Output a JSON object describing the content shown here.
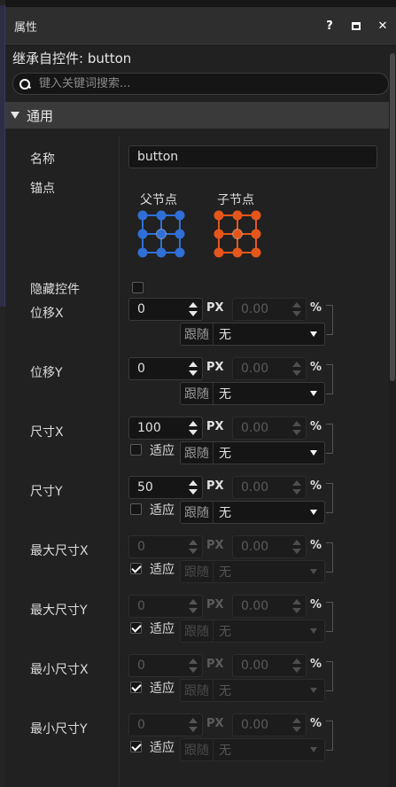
{
  "panel": {
    "title": "属性",
    "help_label": "?",
    "close_label": "✕"
  },
  "inherit_text": "继承自控件: button",
  "search": {
    "placeholder": "键入关键词搜索..."
  },
  "section": {
    "label": "通用"
  },
  "name_field": {
    "label": "名称",
    "value": "button"
  },
  "anchor": {
    "label": "锚点",
    "parent_label": "父节点",
    "child_label": "子节点",
    "parent_color": "#2f6fd6",
    "child_color": "#e5561b"
  },
  "hide_control": {
    "label": "隐藏控件",
    "checked": false
  },
  "rows": [
    {
      "label": "位移X",
      "value": "0",
      "unit": "PX",
      "pct_value": "0.00",
      "pct_unit": "%",
      "fit_label": "",
      "fit_checked": false,
      "follow_tag": "跟随",
      "follow_value": "无"
    },
    {
      "label": "位移Y",
      "value": "0",
      "unit": "PX",
      "pct_value": "0.00",
      "pct_unit": "%",
      "fit_label": "",
      "fit_checked": false,
      "follow_tag": "跟随",
      "follow_value": "无"
    },
    {
      "label": "尺寸X",
      "value": "100",
      "unit": "PX",
      "pct_value": "0.00",
      "pct_unit": "%",
      "fit_label": "适应",
      "fit_checked": false,
      "follow_tag": "跟随",
      "follow_value": "无"
    },
    {
      "label": "尺寸Y",
      "value": "50",
      "unit": "PX",
      "pct_value": "0.00",
      "pct_unit": "%",
      "fit_label": "适应",
      "fit_checked": false,
      "follow_tag": "跟随",
      "follow_value": "无"
    },
    {
      "label": "最大尺寸X",
      "value": "0",
      "unit": "PX",
      "pct_value": "0.00",
      "pct_unit": "%",
      "fit_label": "适应",
      "fit_checked": true,
      "follow_tag": "跟随",
      "follow_value": "无"
    },
    {
      "label": "最大尺寸Y",
      "value": "0",
      "unit": "PX",
      "pct_value": "0.00",
      "pct_unit": "%",
      "fit_label": "适应",
      "fit_checked": true,
      "follow_tag": "跟随",
      "follow_value": "无"
    },
    {
      "label": "最小尺寸X",
      "value": "0",
      "unit": "PX",
      "pct_value": "0.00",
      "pct_unit": "%",
      "fit_label": "适应",
      "fit_checked": true,
      "follow_tag": "跟随",
      "follow_value": "无"
    },
    {
      "label": "最小尺寸Y",
      "value": "0",
      "unit": "PX",
      "pct_value": "0.00",
      "pct_unit": "%",
      "fit_label": "适应",
      "fit_checked": true,
      "follow_tag": "跟随",
      "follow_value": "无"
    }
  ]
}
